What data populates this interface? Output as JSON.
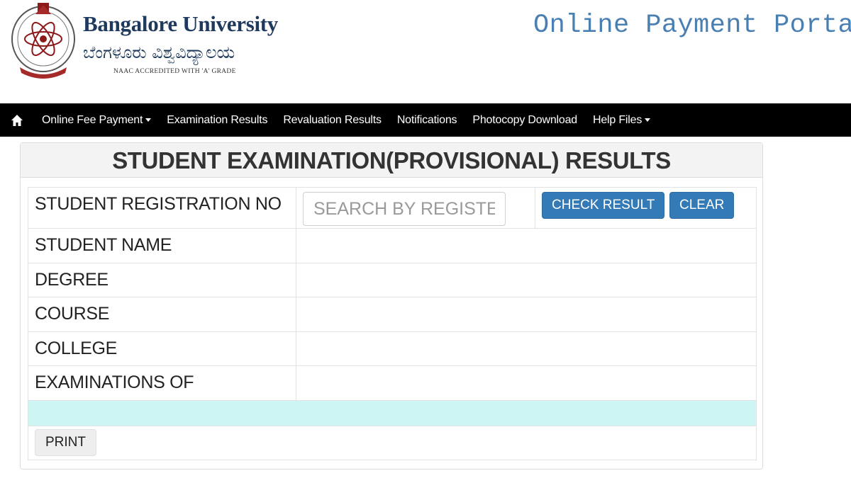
{
  "header": {
    "university_name": "Bangalore University",
    "university_name_kannada": "ಬೆಂಗಳೂರು ವಿಶ್ವವಿದ್ಯಾಲಯ",
    "accreditation": "NAAC ACCREDITED WITH 'A' GRADE",
    "portal_title": "Online Payment Portal",
    "logo_icon": "university-emblem-icon"
  },
  "navbar": {
    "home_icon": "home-icon",
    "items": [
      {
        "label": "Online Fee Payment",
        "dropdown": true
      },
      {
        "label": "Examination Results",
        "dropdown": false
      },
      {
        "label": "Revaluation Results",
        "dropdown": false
      },
      {
        "label": "Notifications",
        "dropdown": false
      },
      {
        "label": "Photocopy Download",
        "dropdown": false
      },
      {
        "label": "Help Files",
        "dropdown": true
      }
    ]
  },
  "results_panel": {
    "title": "STUDENT EXAMINATION(PROVISIONAL) RESULTS",
    "registration_label": "STUDENT REGISTRATION NO",
    "search_placeholder": "SEARCH BY REGISTER NO",
    "search_value": "",
    "check_button": "CHECK RESULT",
    "clear_button": "CLEAR",
    "fields": [
      {
        "label": "STUDENT NAME",
        "value": ""
      },
      {
        "label": "DEGREE",
        "value": ""
      },
      {
        "label": "COURSE",
        "value": ""
      },
      {
        "label": "COLLEGE",
        "value": ""
      },
      {
        "label": "EXAMINATIONS OF",
        "value": ""
      }
    ],
    "print_button": "PRINT"
  },
  "colors": {
    "navbar_bg": "#000000",
    "primary_button": "#337ab7",
    "portal_title": "#4a7fb1",
    "university_name": "#1f3a5c",
    "highlight_row": "#cdf5f3"
  }
}
